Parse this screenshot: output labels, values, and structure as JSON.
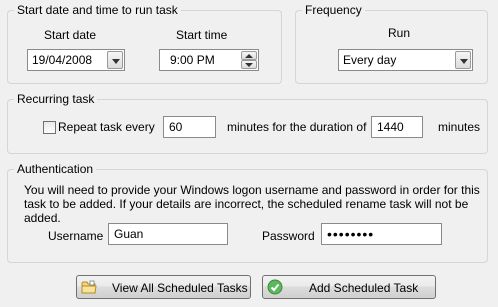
{
  "schedule": {
    "title": "Start date and time to run task",
    "start_date_label": "Start date",
    "start_date_value": "19/04/2008",
    "start_time_label": "Start time",
    "start_time_value": "9:00 PM"
  },
  "frequency": {
    "title": "Frequency",
    "run_label": "Run",
    "run_value": "Every day"
  },
  "recurring": {
    "title": "Recurring task",
    "repeat_label": "Repeat task every",
    "repeat_checked": false,
    "repeat_value": "60",
    "duration_label": "minutes for the duration of",
    "duration_value": "1440",
    "minutes_label": "minutes"
  },
  "authentication": {
    "title": "Authentication",
    "description": "You will need to provide your Windows logon username and password in order for this task to be added.  If your details are incorrect, the scheduled rename task will not be added.",
    "username_label": "Username",
    "username_value": "Guan",
    "password_label": "Password",
    "password_value": "••••••••"
  },
  "buttons": {
    "view_label": "View All Scheduled Tasks",
    "add_label": "Add Scheduled Task"
  },
  "icons": {
    "view": "folder-icon",
    "add": "checkmark-icon"
  }
}
